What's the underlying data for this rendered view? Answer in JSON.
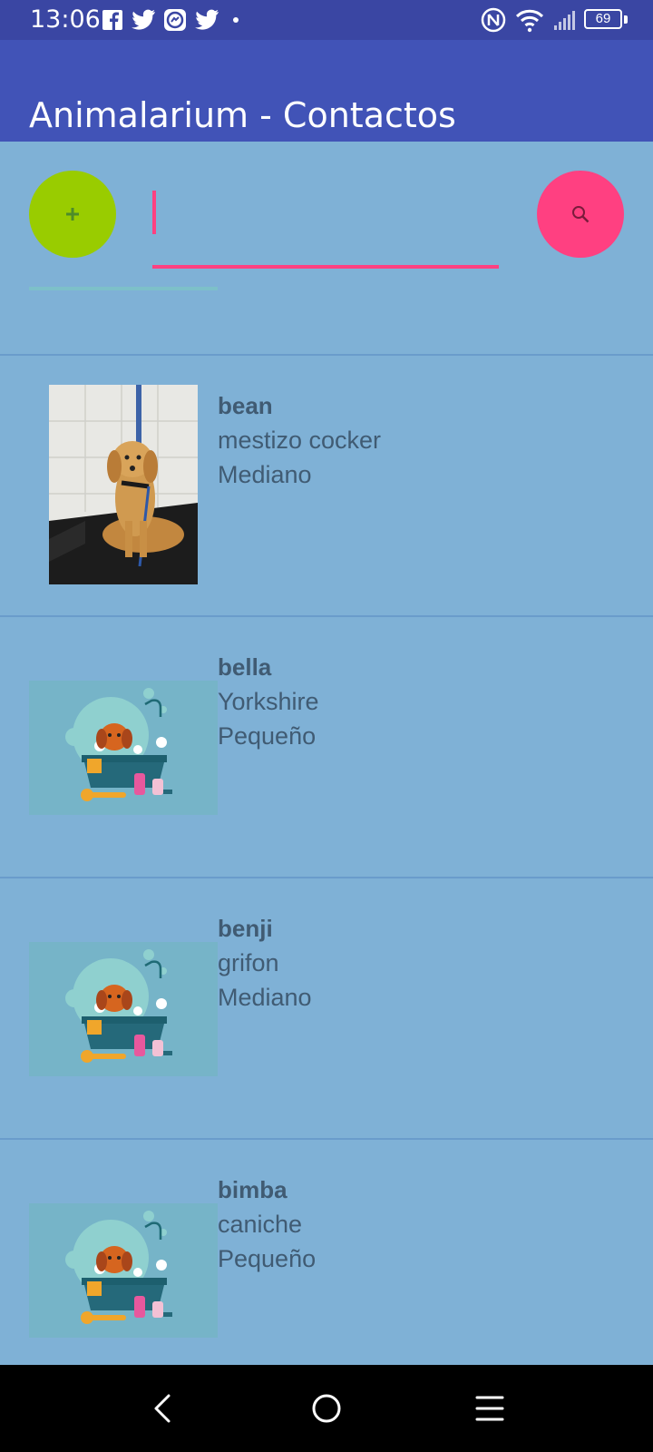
{
  "status_bar": {
    "time": "13:06",
    "left_icons": [
      "facebook-icon",
      "twitter-icon",
      "messenger-icon",
      "twitter-icon",
      "dot-icon"
    ],
    "right_icons": [
      "nfc-icon",
      "wifi-icon",
      "signal-icon",
      "battery-icon"
    ],
    "battery": "69"
  },
  "app_bar": {
    "title": "Animalarium - Contactos"
  },
  "toolbar": {
    "add_icon": "plus-icon",
    "search_icon": "search-icon",
    "search_value": "",
    "search_placeholder": ""
  },
  "contacts": [
    {
      "name": "bean",
      "breed": "mestizo cocker",
      "size": "Mediano",
      "image": "photo"
    },
    {
      "name": "bella",
      "breed": "Yorkshire",
      "size": "Pequeño",
      "image": "illustration"
    },
    {
      "name": "benji",
      "breed": "grifon",
      "size": "Mediano",
      "image": "illustration"
    },
    {
      "name": "bimba",
      "breed": "caniche",
      "size": "Pequeño",
      "image": "illustration"
    }
  ],
  "nav_bar": {
    "icons": [
      "back-icon",
      "home-icon",
      "menu-icon"
    ]
  },
  "colors": {
    "status_bar": "#3a46a3",
    "app_bar": "#4153b7",
    "background": "#7fb1d6",
    "add_fab": "#99cc00",
    "search_fab": "#ff4081",
    "text": "#405b73"
  }
}
